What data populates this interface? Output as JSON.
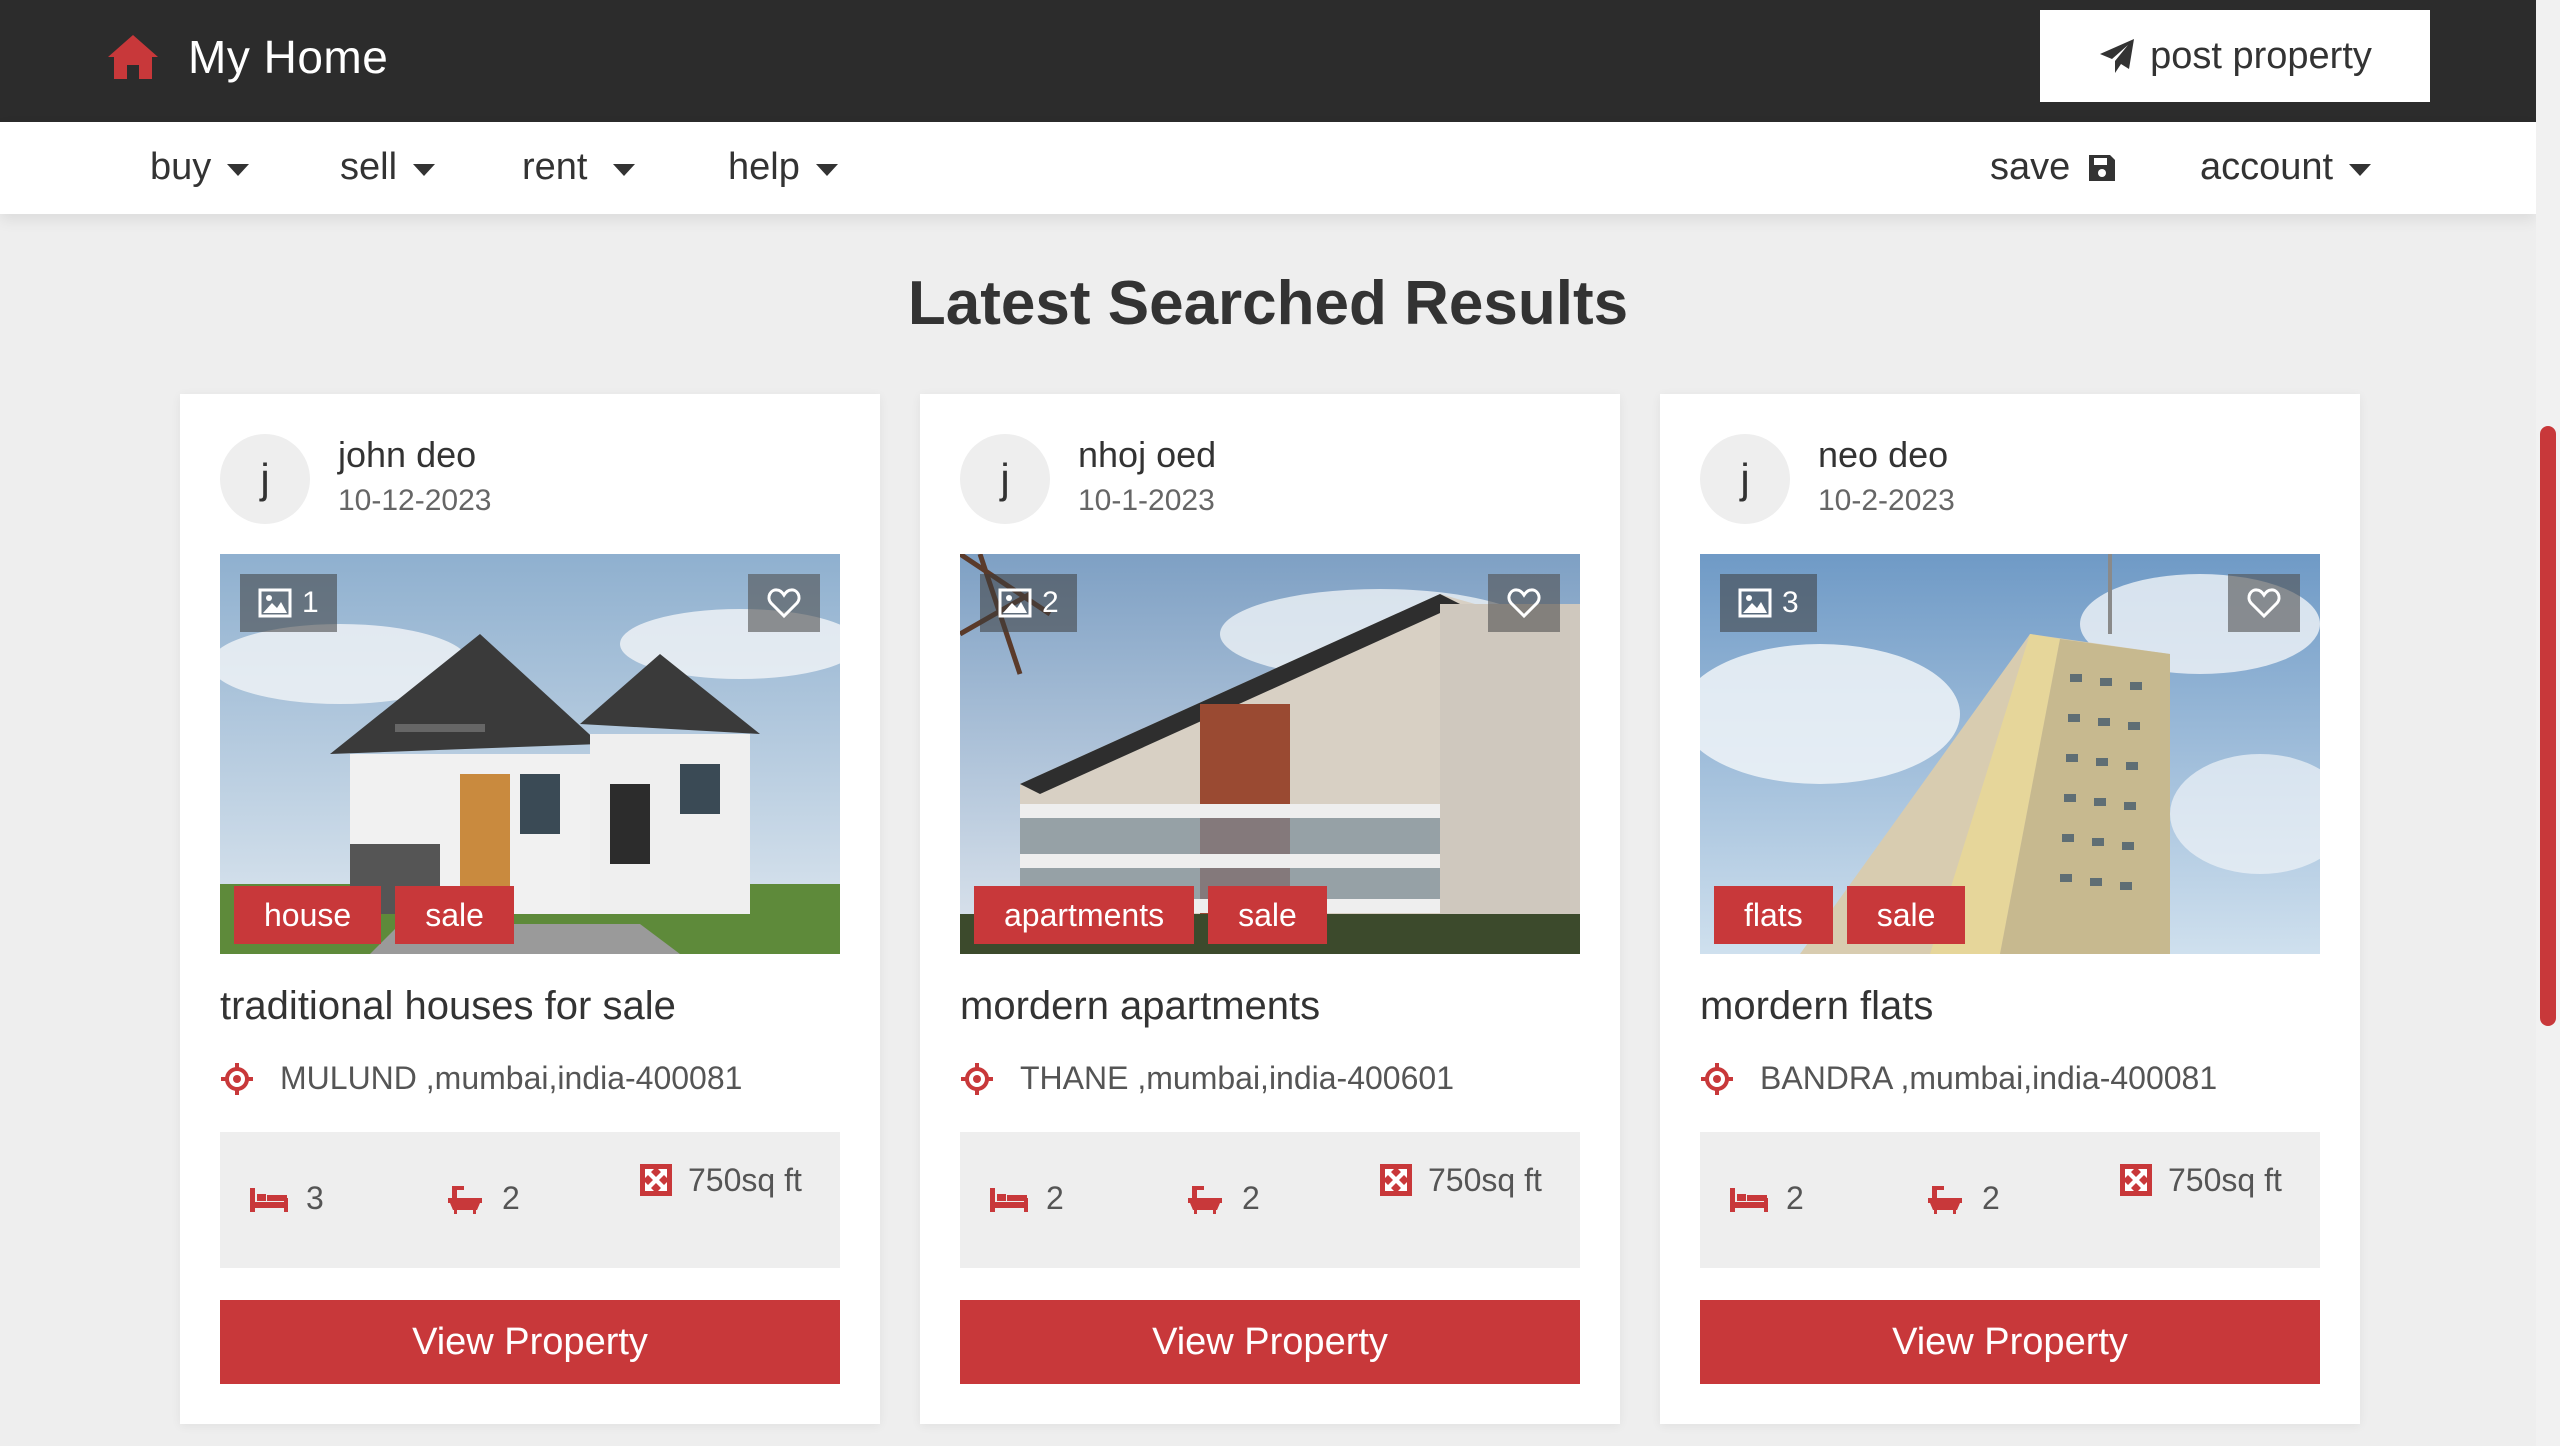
{
  "header": {
    "logo_text": "My Home",
    "post_property_label": "post property"
  },
  "nav": {
    "items": [
      {
        "label": "buy"
      },
      {
        "label": "sell"
      },
      {
        "label": "rent"
      },
      {
        "label": "help"
      }
    ],
    "save_label": "save",
    "account_label": "account"
  },
  "section": {
    "title": "Latest Searched Results"
  },
  "colors": {
    "accent": "#c8383a",
    "header_bg": "#2c2c2c",
    "page_bg": "#eeeeee"
  },
  "cards": [
    {
      "avatar_letter": "j",
      "author": "john deo",
      "date": "10-12-2023",
      "image_count": "1",
      "tags": [
        "house",
        "sale"
      ],
      "title": "traditional houses for sale",
      "location": "MULUND ,mumbai,india-400081",
      "beds": "3",
      "baths": "2",
      "area": "750sq ft",
      "button_label": "View Property"
    },
    {
      "avatar_letter": "j",
      "author": "nhoj oed",
      "date": "10-1-2023",
      "image_count": "2",
      "tags": [
        "apartments",
        "sale"
      ],
      "title": "mordern apartments",
      "location": "THANE ,mumbai,india-400601",
      "beds": "2",
      "baths": "2",
      "area": "750sq ft",
      "button_label": "View Property"
    },
    {
      "avatar_letter": "j",
      "author": "neo deo",
      "date": "10-2-2023",
      "image_count": "3",
      "tags": [
        "flats",
        "sale"
      ],
      "title": "mordern flats",
      "location": "BANDRA ,mumbai,india-400081",
      "beds": "2",
      "baths": "2",
      "area": "750sq ft",
      "button_label": "View Property"
    }
  ],
  "icons": [
    "home-icon",
    "paper-plane-icon",
    "floppy-disk-icon",
    "chevron-down-icon",
    "image-icon",
    "heart-icon",
    "map-marker-icon",
    "bed-icon",
    "bath-icon",
    "area-icon"
  ]
}
